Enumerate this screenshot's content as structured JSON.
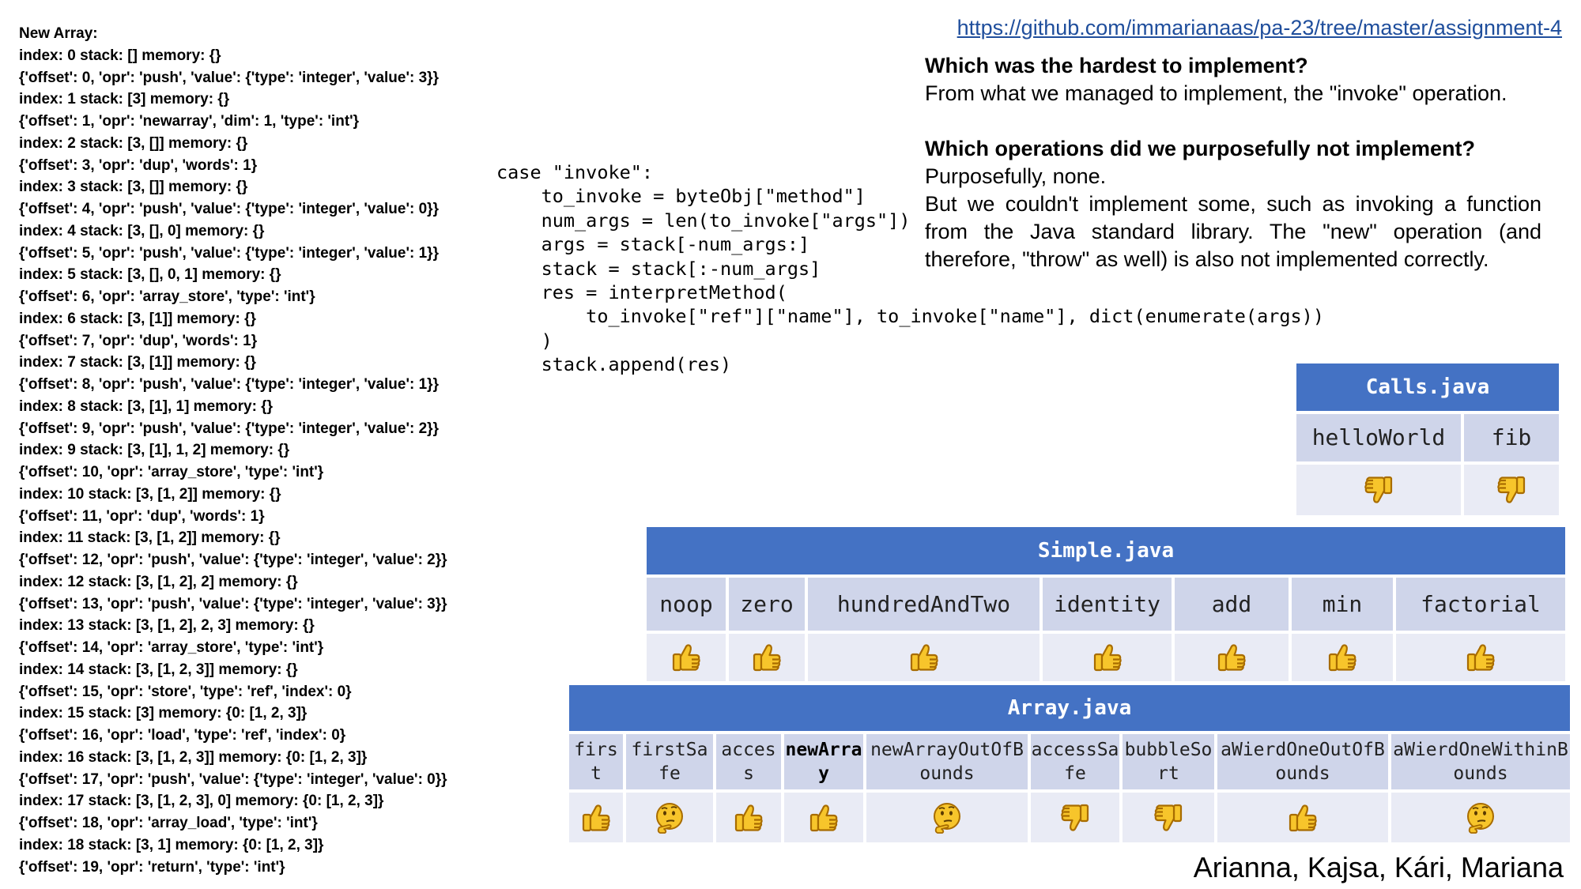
{
  "trace": [
    "New Array:",
    "index: 0 stack:  [] memory: {}",
    "{'offset': 0, 'opr': 'push', 'value': {'type': 'integer', 'value': 3}}",
    "index: 1 stack:  [3] memory: {}",
    "{'offset': 1, 'opr': 'newarray', 'dim': 1, 'type': 'int'}",
    "index: 2 stack:  [3, []] memory: {}",
    "{'offset': 3, 'opr': 'dup', 'words': 1}",
    "index: 3 stack:  [3, []] memory: {}",
    "{'offset': 4, 'opr': 'push', 'value': {'type': 'integer', 'value': 0}}",
    "index: 4 stack:  [3, [], 0] memory: {}",
    "{'offset': 5, 'opr': 'push', 'value': {'type': 'integer', 'value': 1}}",
    "index: 5 stack:  [3, [], 0, 1] memory: {}",
    "{'offset': 6, 'opr': 'array_store', 'type': 'int'}",
    "index: 6 stack:  [3, [1]] memory: {}",
    "{'offset': 7, 'opr': 'dup', 'words': 1}",
    "index: 7 stack:  [3, [1]] memory: {}",
    "{'offset': 8, 'opr': 'push', 'value': {'type': 'integer', 'value': 1}}",
    "index: 8 stack:  [3, [1], 1] memory: {}",
    "{'offset': 9, 'opr': 'push', 'value': {'type': 'integer', 'value': 2}}",
    "index: 9 stack:  [3, [1], 1, 2] memory: {}",
    "{'offset': 10, 'opr': 'array_store', 'type': 'int'}",
    "index: 10 stack:  [3, [1, 2]] memory: {}",
    "{'offset': 11, 'opr': 'dup', 'words': 1}",
    "index: 11 stack:  [3, [1, 2]] memory: {}",
    "{'offset': 12, 'opr': 'push', 'value': {'type': 'integer', 'value': 2}}",
    "index: 12 stack:  [3, [1, 2], 2] memory: {}",
    "{'offset': 13, 'opr': 'push', 'value': {'type': 'integer', 'value': 3}}",
    "index: 13 stack:  [3, [1, 2], 2, 3] memory: {}",
    "{'offset': 14, 'opr': 'array_store', 'type': 'int'}",
    "index: 14 stack:  [3, [1, 2, 3]] memory: {}",
    "{'offset': 15, 'opr': 'store', 'type': 'ref', 'index': 0}",
    "index: 15 stack:  [3] memory: {0: [1, 2, 3]}",
    "{'offset': 16, 'opr': 'load', 'type': 'ref', 'index': 0}",
    "index: 16 stack:  [3, [1, 2, 3]] memory: {0: [1, 2, 3]}",
    "{'offset': 17, 'opr': 'push', 'value': {'type': 'integer', 'value': 0}}",
    "index: 17 stack:  [3, [1, 2, 3], 0] memory: {0: [1, 2, 3]}",
    "{'offset': 18, 'opr': 'array_load', 'type': 'int'}",
    "index: 18 stack:  [3, 1] memory: {0: [1, 2, 3]}",
    "{'offset': 19, 'opr': 'return', 'type': 'int'}"
  ],
  "repo_link": "https://github.com/immarianaas/pa-23/tree/master/assignment-4",
  "qa": {
    "q1": "Which was the hardest to implement?",
    "a1": "From what we managed to implement, the \"invoke\" operation.",
    "q2": "Which operations did we purposefully not implement?",
    "a2_line1": "Purposefully, none.",
    "a2_line2": "But we couldn't  implement some, such as invoking a function from the Java standard library. The \"new\" operation (and therefore, \"throw\" as well) is also not implemented correctly."
  },
  "code": "case \"invoke\":\n    to_invoke = byteObj[\"method\"]\n    num_args = len(to_invoke[\"args\"])\n    args = stack[-num_args:]\n    stack = stack[:-num_args]\n    res = interpretMethod(\n        to_invoke[\"ref\"][\"name\"], to_invoke[\"name\"], dict(enumerate(args))\n    )\n    stack.append(res)",
  "tables": {
    "calls": {
      "title": "Calls.java",
      "methods": [
        {
          "name": "helloWorld",
          "result": "thumbs-down"
        },
        {
          "name": "fib",
          "result": "thumbs-down"
        }
      ]
    },
    "simple": {
      "title": "Simple.java",
      "methods": [
        {
          "name": "noop",
          "result": "thumbs-up"
        },
        {
          "name": "zero",
          "result": "thumbs-up"
        },
        {
          "name": "hundredAndTwo",
          "result": "thumbs-up"
        },
        {
          "name": "identity",
          "result": "thumbs-up"
        },
        {
          "name": "add",
          "result": "thumbs-up"
        },
        {
          "name": "min",
          "result": "thumbs-up"
        },
        {
          "name": "factorial",
          "result": "thumbs-up"
        }
      ]
    },
    "array": {
      "title": "Array.java",
      "methods": [
        {
          "name": "first",
          "result": "thumbs-up"
        },
        {
          "name": "firstSafe",
          "result": "thinking"
        },
        {
          "name": "access",
          "result": "thumbs-up"
        },
        {
          "name": "newArray",
          "result": "thumbs-up",
          "bold": true
        },
        {
          "name": "newArrayOutOfBounds",
          "result": "thinking"
        },
        {
          "name": "accessSafe",
          "result": "thumbs-down"
        },
        {
          "name": "bubbleSort",
          "result": "thumbs-down"
        },
        {
          "name": "aWierdOneOutOfBounds",
          "result": "thumbs-up"
        },
        {
          "name": "aWierdOneWithinBounds",
          "result": "thinking"
        }
      ]
    }
  },
  "authors": "Arianna, Kajsa, Kári, Mariana",
  "colors": {
    "header_blue": "#4472c4",
    "name_cell": "#cfd5ea",
    "vote_cell": "#e9ebf5",
    "emoji_yellow": "#f7c52b",
    "emoji_outline": "#a86c00",
    "link": "#1f4e9c"
  }
}
